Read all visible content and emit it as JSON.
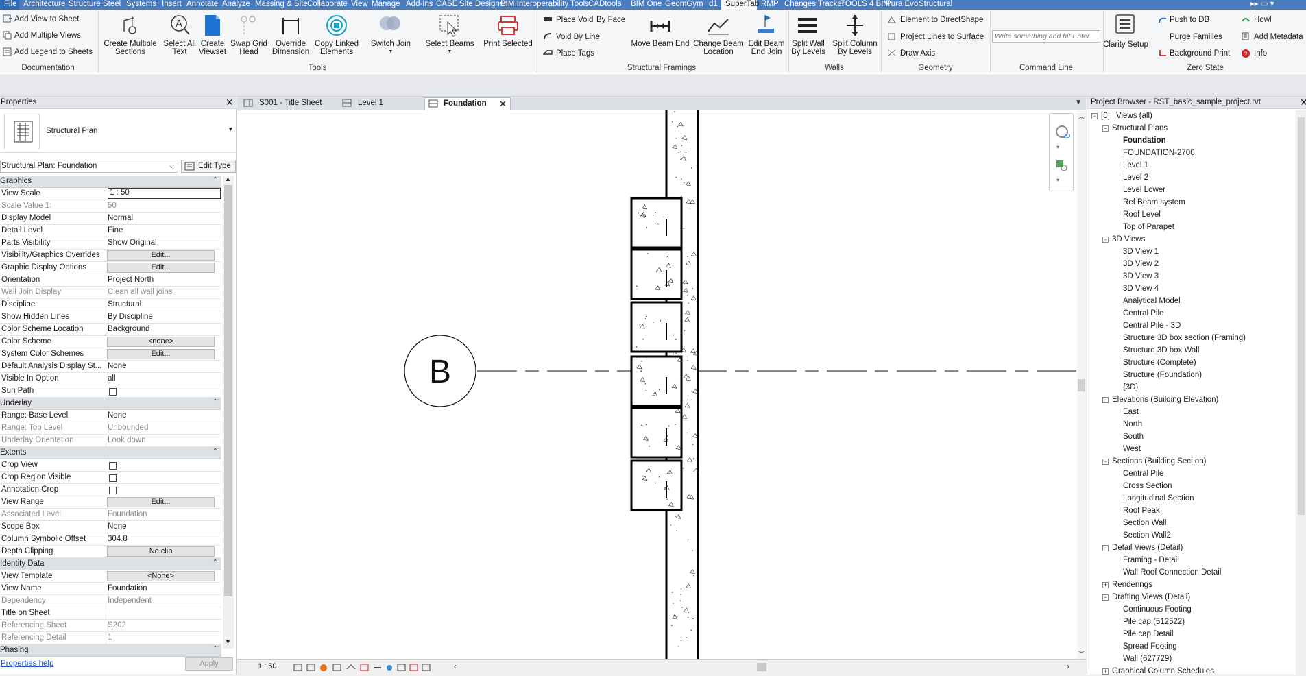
{
  "menu": {
    "tabs": [
      "File",
      "Architecture",
      "Structure",
      "Steel",
      "Systems",
      "Insert",
      "Annotate",
      "Analyze",
      "Massing & Site",
      "Collaborate",
      "View",
      "Manage",
      "Add-Ins",
      "CASE",
      "Site Designer",
      "BIM Interoperability Tools",
      "CADtools",
      "BIM One",
      "GeomGym",
      "d1",
      "SuperTab",
      "RMP",
      "Changes Tracker",
      "TOOLS 4 BIM",
      "Pura Evo",
      "Structural"
    ],
    "active_tab": "SuperTab"
  },
  "ribbon": {
    "documentation": {
      "title": "Documentation",
      "items": [
        "Add View to Sheet",
        "Add Multiple Views",
        "Add Legend to Sheets"
      ]
    },
    "tools": {
      "title": "Tools",
      "items": [
        {
          "l1": "Create Multiple",
          "l2": "Sections",
          "icon": "create-multiple-sections-icon"
        },
        {
          "l1": "Select All",
          "l2": "Text",
          "icon": "select-all-text-icon"
        },
        {
          "l1": "Create",
          "l2": "Viewset",
          "icon": "create-viewset-icon"
        },
        {
          "l1": "Swap Grid",
          "l2": "Head",
          "icon": "swap-grid-head-icon"
        },
        {
          "l1": "Override",
          "l2": "Dimension",
          "icon": "override-dimension-icon"
        },
        {
          "l1": "Copy Linked",
          "l2": "Elements",
          "icon": "copy-linked-elements-icon"
        },
        {
          "l1": "Switch Join",
          "l2": "",
          "icon": "switch-join-icon"
        },
        {
          "l1": "Select Beams",
          "l2": "",
          "icon": "select-beams-icon"
        },
        {
          "l1": "Print Selected",
          "l2": "",
          "icon": "print-selected-icon"
        }
      ]
    },
    "structural_framings": {
      "title": "Structural Framings",
      "small": [
        "Place Void",
        "By Face",
        "Void By Line",
        "Place Tags"
      ],
      "items": [
        {
          "l1": "Move Beam End",
          "l2": ""
        },
        {
          "l1": "Change Beam",
          "l2": "Location"
        },
        {
          "l1": "Edit Beam",
          "l2": "End Join"
        }
      ]
    },
    "walls": {
      "title": "Walls",
      "items": [
        {
          "l1": "Split Wall",
          "l2": "By Levels"
        },
        {
          "l1": "Split Column",
          "l2": "By Levels"
        }
      ]
    },
    "geometry": {
      "title": "Geometry",
      "items": [
        "Element to DirectShape",
        "Project Lines to Surface",
        "Draw Axis"
      ]
    },
    "command_line": {
      "title": "Command Line",
      "placeholder": "Write something and hit Enter"
    },
    "zero_state": {
      "title": "Zero State",
      "clarity": "Clarity Setup",
      "items": [
        "Push to DB",
        "Purge Families",
        "Background  Print"
      ],
      "right": [
        "Howl",
        "Add Metadata",
        "Info"
      ]
    }
  },
  "properties": {
    "title": "Properties",
    "type_name": "Structural Plan",
    "selector": "Structural Plan: Foundation",
    "edit_type": "Edit Type",
    "rows": [
      {
        "kind": "cat",
        "name": "Graphics"
      },
      {
        "kind": "input",
        "name": "View Scale",
        "value": "1 : 50"
      },
      {
        "kind": "text",
        "name": "Scale Value    1:",
        "value": "50",
        "dim": true
      },
      {
        "kind": "text",
        "name": "Display Model",
        "value": "Normal"
      },
      {
        "kind": "text",
        "name": "Detail Level",
        "value": "Fine"
      },
      {
        "kind": "text",
        "name": "Parts Visibility",
        "value": "Show Original"
      },
      {
        "kind": "btn",
        "name": "Visibility/Graphics Overrides",
        "value": "Edit..."
      },
      {
        "kind": "btn",
        "name": "Graphic Display Options",
        "value": "Edit..."
      },
      {
        "kind": "text",
        "name": "Orientation",
        "value": "Project North"
      },
      {
        "kind": "text",
        "name": "Wall Join Display",
        "value": "Clean all wall joins",
        "dim": true
      },
      {
        "kind": "text",
        "name": "Discipline",
        "value": "Structural"
      },
      {
        "kind": "text",
        "name": "Show Hidden Lines",
        "value": "By Discipline"
      },
      {
        "kind": "text",
        "name": "Color Scheme Location",
        "value": "Background"
      },
      {
        "kind": "btn",
        "name": "Color Scheme",
        "value": "<none>"
      },
      {
        "kind": "btn",
        "name": "System Color Schemes",
        "value": "Edit..."
      },
      {
        "kind": "text",
        "name": "Default Analysis Display St...",
        "value": "None"
      },
      {
        "kind": "text",
        "name": "Visible In Option",
        "value": "all"
      },
      {
        "kind": "check",
        "name": "Sun Path",
        "value": ""
      },
      {
        "kind": "cat",
        "name": "Underlay"
      },
      {
        "kind": "text",
        "name": "Range: Base Level",
        "value": "None"
      },
      {
        "kind": "text",
        "name": "Range: Top Level",
        "value": "Unbounded",
        "dim": true
      },
      {
        "kind": "text",
        "name": "Underlay Orientation",
        "value": "Look down",
        "dim": true
      },
      {
        "kind": "cat",
        "name": "Extents"
      },
      {
        "kind": "check",
        "name": "Crop View",
        "value": ""
      },
      {
        "kind": "check",
        "name": "Crop Region Visible",
        "value": ""
      },
      {
        "kind": "check",
        "name": "Annotation Crop",
        "value": ""
      },
      {
        "kind": "btn",
        "name": "View Range",
        "value": "Edit..."
      },
      {
        "kind": "text",
        "name": "Associated Level",
        "value": "Foundation",
        "dim": true
      },
      {
        "kind": "text",
        "name": "Scope Box",
        "value": "None"
      },
      {
        "kind": "text",
        "name": "Column Symbolic Offset",
        "value": "304.8"
      },
      {
        "kind": "btn",
        "name": "Depth Clipping",
        "value": "No clip"
      },
      {
        "kind": "cat",
        "name": "Identity Data"
      },
      {
        "kind": "btn",
        "name": "View Template",
        "value": "<None>"
      },
      {
        "kind": "text",
        "name": "View Name",
        "value": "Foundation"
      },
      {
        "kind": "text",
        "name": "Dependency",
        "value": "Independent",
        "dim": true
      },
      {
        "kind": "text",
        "name": "Title on Sheet",
        "value": ""
      },
      {
        "kind": "text",
        "name": "Referencing Sheet",
        "value": "S202",
        "dim": true
      },
      {
        "kind": "text",
        "name": "Referencing Detail",
        "value": "1",
        "dim": true
      },
      {
        "kind": "cat",
        "name": "Phasing"
      }
    ],
    "help_link": "Properties help",
    "apply": "Apply"
  },
  "view_tabs": [
    {
      "label": "S001 - Title Sheet",
      "active": false
    },
    {
      "label": "Level 1",
      "active": false
    },
    {
      "label": "Foundation",
      "active": true
    }
  ],
  "canvas": {
    "grid_bubble": "B",
    "scale": "1 : 50"
  },
  "browser": {
    "title": "Project Browser - RST_basic_sample_project.rvt",
    "tree": [
      {
        "level": 0,
        "label": "Views (all)",
        "box": "-"
      },
      {
        "level": 1,
        "label": "Structural Plans",
        "box": "-"
      },
      {
        "level": 2,
        "label": "Foundation",
        "bold": true
      },
      {
        "level": 2,
        "label": "FOUNDATION-2700"
      },
      {
        "level": 2,
        "label": "Level 1"
      },
      {
        "level": 2,
        "label": "Level 2"
      },
      {
        "level": 2,
        "label": "Level Lower"
      },
      {
        "level": 2,
        "label": "Ref Beam system"
      },
      {
        "level": 2,
        "label": "Roof Level"
      },
      {
        "level": 2,
        "label": "Top of Parapet"
      },
      {
        "level": 1,
        "label": "3D Views",
        "box": "-"
      },
      {
        "level": 2,
        "label": "3D View 1"
      },
      {
        "level": 2,
        "label": "3D View 2"
      },
      {
        "level": 2,
        "label": "3D View 3"
      },
      {
        "level": 2,
        "label": "3D View 4"
      },
      {
        "level": 2,
        "label": "Analytical Model"
      },
      {
        "level": 2,
        "label": "Central Pile"
      },
      {
        "level": 2,
        "label": "Central Pile - 3D"
      },
      {
        "level": 2,
        "label": "Structure 3D box section (Framing)"
      },
      {
        "level": 2,
        "label": "Structure 3D box Wall"
      },
      {
        "level": 2,
        "label": "Structure (Complete)"
      },
      {
        "level": 2,
        "label": "Structure (Foundation)"
      },
      {
        "level": 2,
        "label": "{3D}"
      },
      {
        "level": 1,
        "label": "Elevations (Building Elevation)",
        "box": "-"
      },
      {
        "level": 2,
        "label": "East"
      },
      {
        "level": 2,
        "label": "North"
      },
      {
        "level": 2,
        "label": "South"
      },
      {
        "level": 2,
        "label": "West"
      },
      {
        "level": 1,
        "label": "Sections (Building Section)",
        "box": "-"
      },
      {
        "level": 2,
        "label": "Central Pile"
      },
      {
        "level": 2,
        "label": "Cross Section"
      },
      {
        "level": 2,
        "label": "Longitudinal Section"
      },
      {
        "level": 2,
        "label": "Roof Peak"
      },
      {
        "level": 2,
        "label": "Section Wall"
      },
      {
        "level": 2,
        "label": "Section Wall2"
      },
      {
        "level": 1,
        "label": "Detail Views (Detail)",
        "box": "-"
      },
      {
        "level": 2,
        "label": "Framing - Detail"
      },
      {
        "level": 2,
        "label": "Wall Roof Connection Detail"
      },
      {
        "level": 1,
        "label": "Renderings",
        "box": "+"
      },
      {
        "level": 1,
        "label": "Drafting Views (Detail)",
        "box": "-"
      },
      {
        "level": 2,
        "label": "Continuous Footing"
      },
      {
        "level": 2,
        "label": "Pile cap (512522)"
      },
      {
        "level": 2,
        "label": "Pile cap Detail"
      },
      {
        "level": 2,
        "label": "Spread Footing"
      },
      {
        "level": 2,
        "label": "Wall (627729)"
      },
      {
        "level": 1,
        "label": "Graphical Column Schedules",
        "box": "+"
      }
    ]
  },
  "colors": {
    "menu_bg": "#4a7bbd",
    "accent_blue": "#1e73d2",
    "print_red": "#d33a3a",
    "info_red": "#d0202a"
  }
}
